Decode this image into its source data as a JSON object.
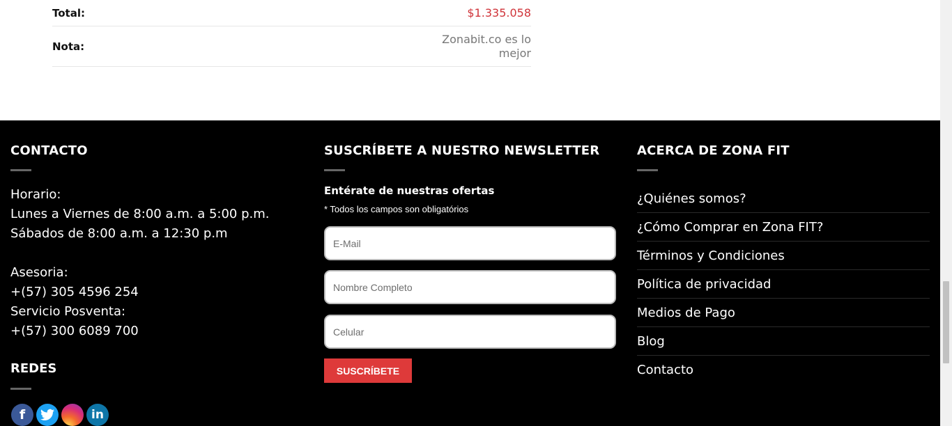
{
  "summary": {
    "total_label": "Total:",
    "total_value": "$1.335.058",
    "nota_label": "Nota:",
    "nota_value": "Zonabit.co es lo mejor"
  },
  "colors": {
    "accent": "#de3a3a",
    "total_red": "#d0343a",
    "footer_bg": "#000000"
  },
  "footer": {
    "contact": {
      "title": "CONTACTO",
      "horario_label": "Horario:",
      "horario_week": "Lunes a Viernes de 8:00 a.m. a 5:00 p.m.",
      "horario_sat": "Sábados de 8:00 a.m. a 12:30 p.m",
      "asesoria_label": "Asesoria:",
      "asesoria_phone": "+(57) 305 4596 254",
      "posventa_label": "Servicio Posventa:",
      "posventa_phone": "+(57) 300 6089 700"
    },
    "redes": {
      "title": "REDES",
      "icons": [
        "facebook-icon",
        "twitter-icon",
        "instagram-icon",
        "linkedin-icon"
      ]
    },
    "newsletter": {
      "title": "SUSCRÍBETE A NUESTRO NEWSLETTER",
      "subtitle": "Entérate de nuestras ofertas",
      "required_note": "* Todos los campos son obligatórios",
      "email_placeholder": "E-Mail",
      "name_placeholder": "Nombre Completo",
      "phone_placeholder": "Celular",
      "button_label": "SUSCRÍBETE"
    },
    "about": {
      "title": "ACERCA DE ZONA FIT",
      "links": [
        "¿Quiénes somos?",
        "¿Cómo Comprar en Zona FIT?",
        "Términos y Condiciones",
        "Política de privacidad",
        "Medios de Pago",
        "Blog",
        "Contacto"
      ]
    }
  }
}
